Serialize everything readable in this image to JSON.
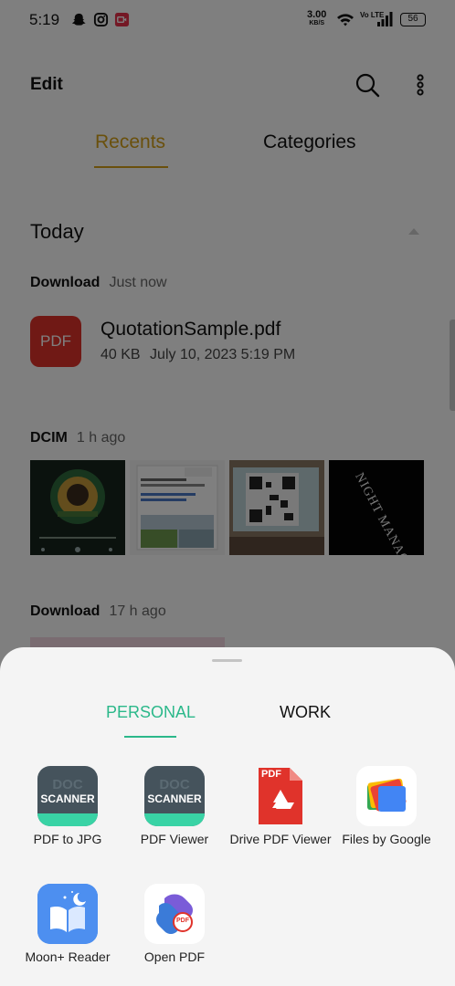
{
  "status_bar": {
    "time": "5:19",
    "speed_value": "3.00",
    "speed_unit": "KB/S",
    "network": "Vo LTE",
    "battery": "56"
  },
  "header": {
    "title": "Edit",
    "tabs": [
      {
        "label": "Recents",
        "active": true
      },
      {
        "label": "Categories",
        "active": false
      }
    ]
  },
  "recents": {
    "section_title": "Today",
    "groups": [
      {
        "source": "Download",
        "time_ago": "Just now",
        "file": {
          "icon_label": "PDF",
          "name": "QuotationSample.pdf",
          "size": "40 KB",
          "date": "July 10, 2023 5:19 PM"
        }
      },
      {
        "source": "DCIM",
        "time_ago": "1 h ago",
        "thumbnails": [
          "music-player-screenshot",
          "youtube-share-screenshot",
          "qr-code-photo",
          "night-manager-poster"
        ]
      },
      {
        "source": "Download",
        "time_ago": "17 h ago"
      }
    ]
  },
  "sheet": {
    "tabs": [
      {
        "label": "PERSONAL",
        "active": true
      },
      {
        "label": "WORK",
        "active": false
      }
    ],
    "apps": [
      {
        "label": "PDF to JPG",
        "icon": "doc-scanner-icon",
        "icon_text_top": "DOC",
        "icon_text_bottom": "SCANNER"
      },
      {
        "label": "PDF Viewer",
        "icon": "doc-scanner-icon",
        "icon_text_top": "DOC",
        "icon_text_bottom": "SCANNER"
      },
      {
        "label": "Drive PDF Viewer",
        "icon": "drive-pdf-icon",
        "icon_text_top": "PDF"
      },
      {
        "label": "Files by Google",
        "icon": "files-google-icon"
      },
      {
        "label": "Moon+ Reader",
        "icon": "moon-reader-icon"
      },
      {
        "label": "Open PDF",
        "icon": "open-pdf-icon",
        "icon_text_top": "PDF"
      }
    ]
  },
  "colors": {
    "accent_recents": "#d4a019",
    "accent_personal": "#2bb88a",
    "pdf_red": "#e0332b"
  }
}
